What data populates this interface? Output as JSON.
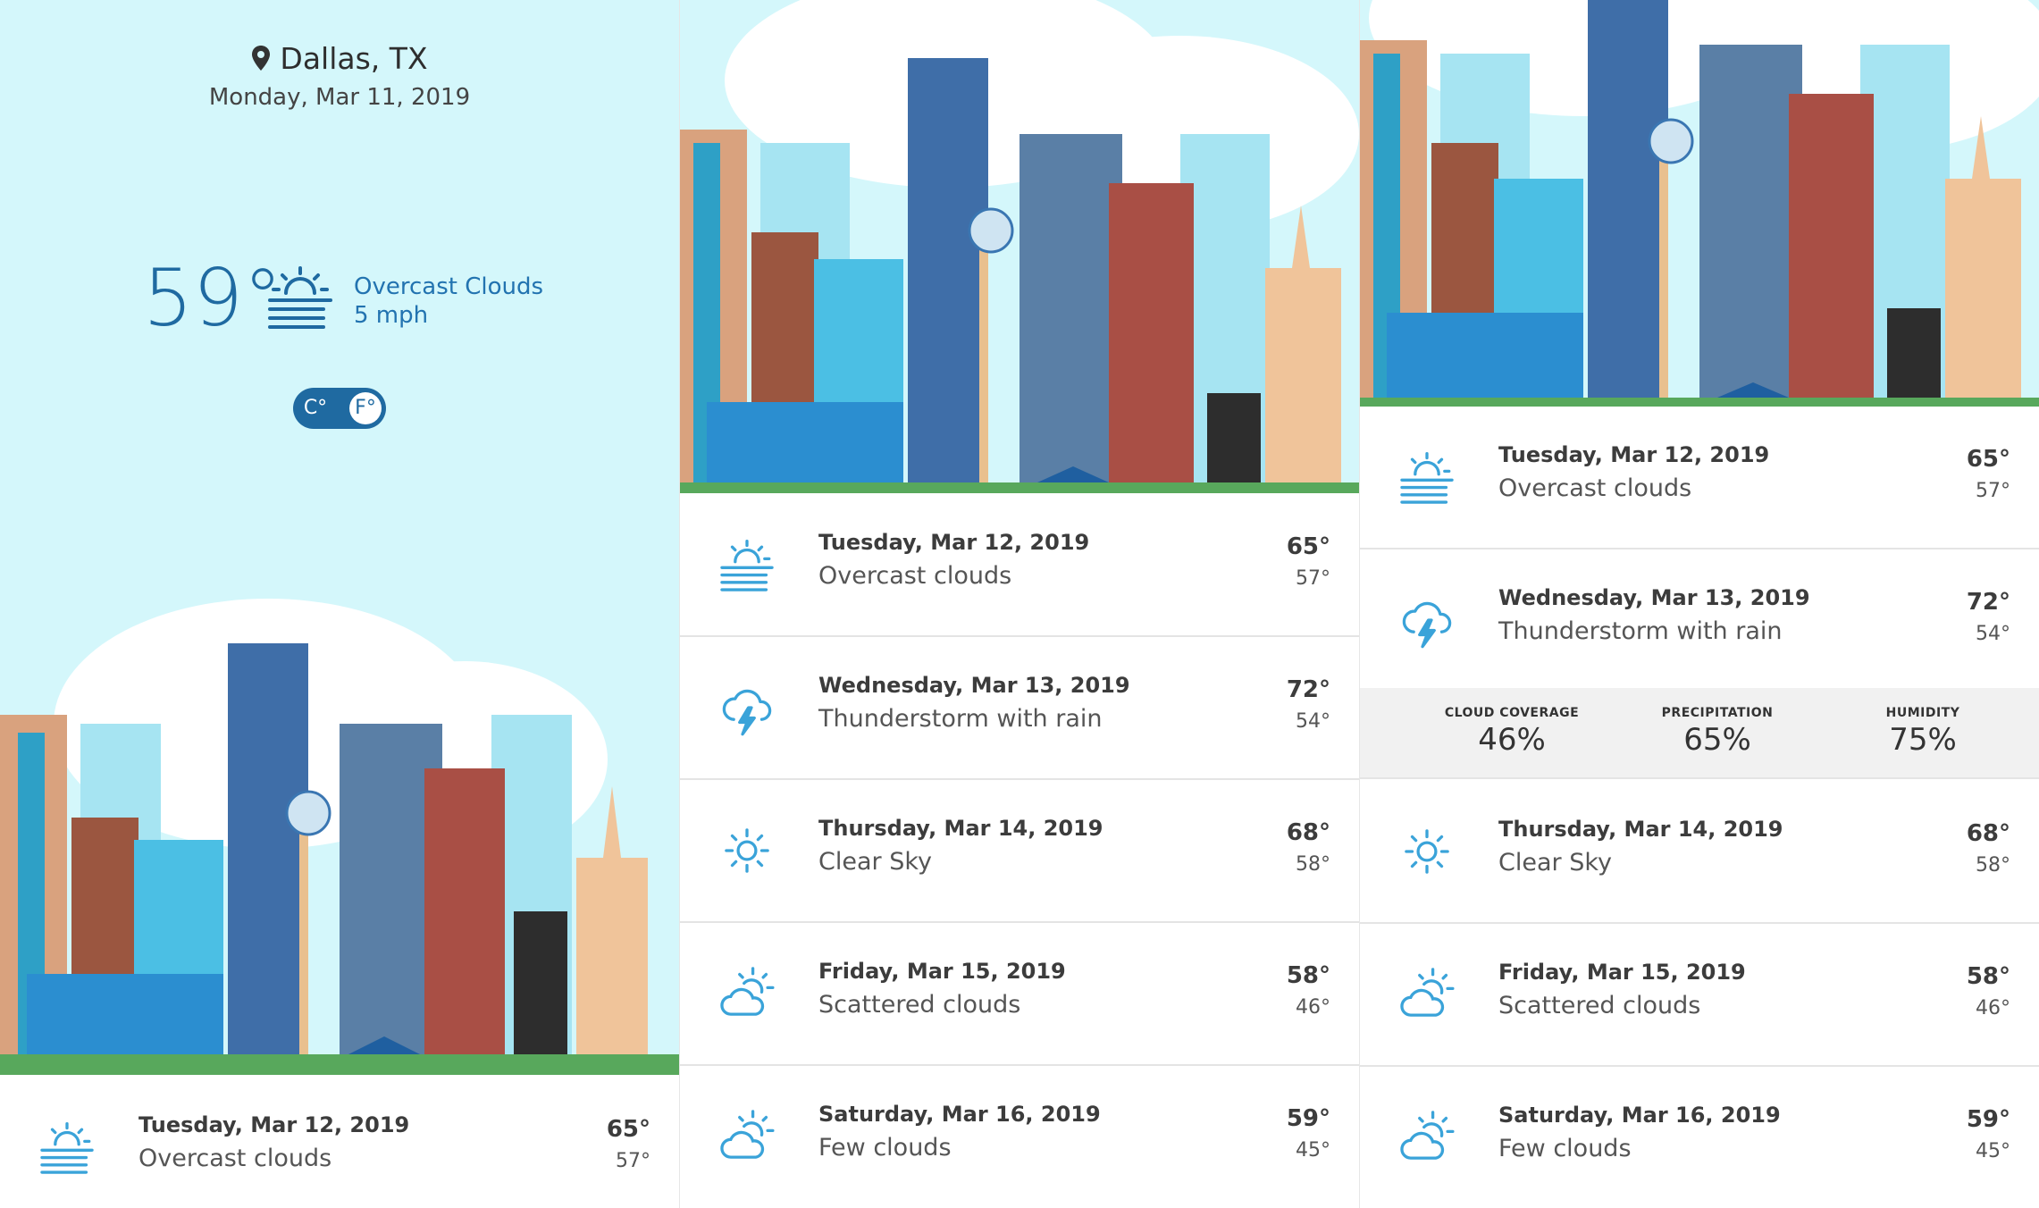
{
  "current": {
    "location": "Dallas, TX",
    "date": "Monday, Mar 11, 2019",
    "temp": "59°",
    "condition": "Overcast Clouds",
    "wind": "5 mph",
    "icon": "overcast-cloud-icon",
    "unit_toggle": {
      "celsius_label": "C°",
      "fahrenheit_label": "F°",
      "selected": "F"
    }
  },
  "colors": {
    "accent": "#1f6aa1",
    "sky": "#d4f7fb",
    "icon_blue": "#3aa3d9"
  },
  "forecast": [
    {
      "day": "Tuesday, Mar 12, 2019",
      "condition": "Overcast clouds",
      "high": "65°",
      "low": "57°",
      "icon": "overcast-cloud-icon"
    },
    {
      "day": "Wednesday, Mar 13, 2019",
      "condition": "Thunderstorm with rain",
      "high": "72°",
      "low": "54°",
      "icon": "thunderstorm-icon"
    },
    {
      "day": "Thursday, Mar 14, 2019",
      "condition": "Clear Sky",
      "high": "68°",
      "low": "58°",
      "icon": "sun-icon"
    },
    {
      "day": "Friday, Mar 15, 2019",
      "condition": "Scattered clouds",
      "high": "58°",
      "low": "46°",
      "icon": "partly-cloudy-icon"
    },
    {
      "day": "Saturday, Mar 16, 2019",
      "condition": "Few clouds",
      "high": "59°",
      "low": "45°",
      "icon": "partly-cloudy-icon"
    }
  ],
  "details": {
    "cloud_coverage_label": "CLOUD COVERAGE",
    "cloud_coverage": "46%",
    "precipitation_label": "PRECIPITATION",
    "precipitation": "65%",
    "humidity_label": "HUMIDITY",
    "humidity": "75%"
  }
}
